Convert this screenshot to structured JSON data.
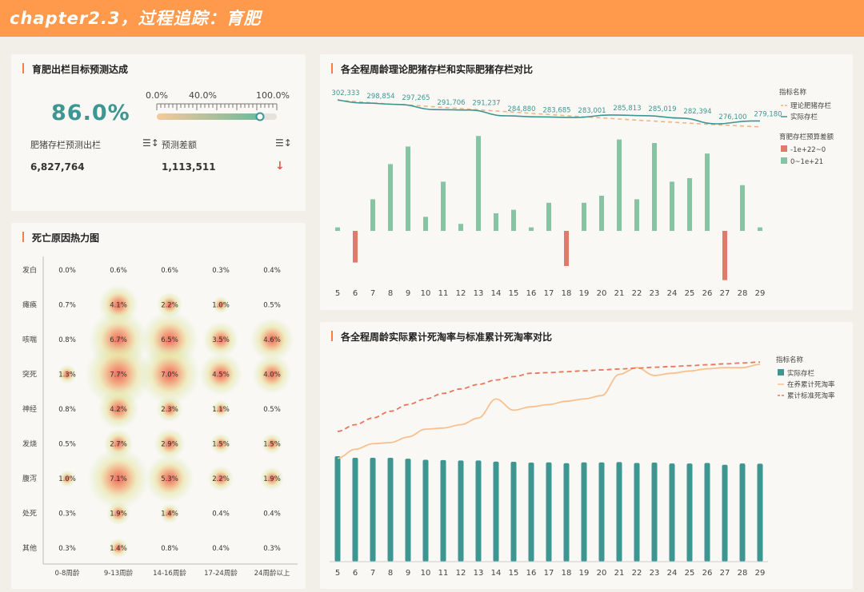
{
  "header": {
    "title": "chapter2.3，过程追踪：育肥"
  },
  "kpi": {
    "title": "育肥出栏目标预测达成",
    "rate": "86.0%",
    "rate_value": 86.0,
    "scale_min": "0.0%",
    "scale_mid": "40.0%",
    "scale_max": "100.0%",
    "metric1_label": "肥猪存栏预测出栏",
    "metric1_value": "6,827,764",
    "metric2_label": "预测差额",
    "metric2_value": "1,113,511"
  },
  "heatmap": {
    "title": "死亡原因热力图",
    "chart_data": {
      "type": "heatmap",
      "rows": [
        "发白",
        "瘫痪",
        "咳喘",
        "突死",
        "神经",
        "发烧",
        "腹泻",
        "处死",
        "其他"
      ],
      "columns": [
        "0-8周龄",
        "9-13周龄",
        "14-16周龄",
        "17-24周龄",
        "24周龄以上"
      ],
      "values": [
        [
          0.0,
          0.6,
          0.6,
          0.3,
          0.4
        ],
        [
          0.7,
          4.1,
          2.2,
          1.0,
          0.5
        ],
        [
          0.8,
          6.7,
          6.5,
          3.5,
          4.6
        ],
        [
          1.3,
          7.7,
          7.0,
          4.5,
          4.0
        ],
        [
          0.8,
          4.2,
          2.3,
          1.1,
          0.5
        ],
        [
          0.5,
          2.7,
          2.9,
          1.5,
          1.5
        ],
        [
          1.0,
          7.1,
          5.3,
          2.2,
          1.9
        ],
        [
          0.3,
          1.9,
          1.4,
          0.4,
          0.4
        ],
        [
          0.3,
          1.4,
          0.8,
          0.4,
          0.3
        ]
      ],
      "labels": [
        [
          "0.0%",
          "0.6%",
          "0.6%",
          "0.3%",
          "0.4%"
        ],
        [
          "0.7%",
          "4.1%",
          "2.2%",
          "1.0%",
          "0.5%"
        ],
        [
          "0.8%",
          "6.7%",
          "6.5%",
          "3.5%",
          "4.6%"
        ],
        [
          "1.3%",
          "7.7%",
          "7.0%",
          "4.5%",
          "4.0%"
        ],
        [
          "0.8%",
          "4.2%",
          "2.3%",
          "1.1%",
          "0.5%"
        ],
        [
          "0.5%",
          "2.7%",
          "2.9%",
          "1.5%",
          "1.5%"
        ],
        [
          "1.0%",
          "7.1%",
          "5.3%",
          "2.2%",
          "1.9%"
        ],
        [
          "0.3%",
          "1.9%",
          "1.4%",
          "0.4%",
          "0.4%"
        ],
        [
          "0.3%",
          "1.4%",
          "0.8%",
          "0.4%",
          "0.3%"
        ]
      ]
    }
  },
  "stockChart": {
    "title": "各全程周龄理论肥猪存栏和实际肥猪存栏对比",
    "chart_data": {
      "type": "line",
      "x": [
        5,
        6,
        7,
        8,
        9,
        10,
        11,
        12,
        13,
        14,
        15,
        16,
        17,
        18,
        19,
        20,
        21,
        22,
        23,
        24,
        25,
        26,
        27,
        28,
        29
      ],
      "series": [
        {
          "name": "理论肥猪存栏",
          "values": [
            302000,
            300500,
            299000,
            297800,
            296700,
            295400,
            294000,
            292800,
            291500,
            290200,
            288900,
            287600,
            286300,
            285000,
            283800,
            282600,
            281400,
            280200,
            279000,
            277900,
            276800,
            275700,
            274700,
            273700,
            272800
          ]
        },
        {
          "name": "实际存栏",
          "values": [
            302333,
            298854,
            298854,
            297265,
            297265,
            291706,
            291706,
            291237,
            291237,
            284880,
            284880,
            283685,
            283685,
            283001,
            283001,
            285813,
            285813,
            285019,
            285019,
            282394,
            282394,
            276100,
            276100,
            279180,
            279180
          ]
        }
      ],
      "point_labels": [
        "302,333",
        "298,854",
        "297,265",
        "291,706",
        "291,237",
        "284,880",
        "283,685",
        "283,001",
        "285,813",
        "285,019",
        "282,394",
        "276,100",
        "279,180"
      ],
      "diff_title": "育肥存栏预算差额",
      "diff_legend": [
        "-1e+22~0",
        "0~1e+21"
      ],
      "diff_values": [
        1,
        -9,
        9,
        19,
        24,
        4,
        14,
        2,
        27,
        5,
        6,
        1,
        8,
        -10,
        8,
        10,
        26,
        9,
        25,
        14,
        15,
        22,
        -14,
        13,
        1
      ],
      "legend_title": "指标名称",
      "colors": {
        "theory": "#f2b07a",
        "actual": "#3d9692",
        "positive": "#86c4a3",
        "negative": "#e07a6a"
      }
    }
  },
  "mortalityChart": {
    "title": "各全程周龄实际累计死淘率与标准累计死淘率对比",
    "chart_data": {
      "type": "bar",
      "x": [
        5,
        6,
        7,
        8,
        9,
        10,
        11,
        12,
        13,
        14,
        15,
        16,
        17,
        18,
        19,
        20,
        21,
        22,
        23,
        24,
        25,
        26,
        27,
        28,
        29
      ],
      "series": [
        {
          "name": "实际存栏",
          "values": [
            100,
            98.5,
            98.5,
            98.5,
            97.6,
            96.6,
            96.3,
            95.9,
            95.9,
            94.9,
            94.7,
            93.9,
            94.1,
            93.4,
            94.1,
            94.1,
            94.4,
            93.6,
            93.9,
            93.1,
            93.1,
            93.6,
            91.9,
            93.1,
            92.9
          ]
        },
        {
          "name": "在养累计死淘率",
          "values": [
            0.8,
            1.2,
            1.45,
            1.5,
            1.75,
            2.1,
            2.15,
            2.3,
            2.6,
            3.45,
            2.95,
            3.1,
            3.2,
            3.35,
            3.45,
            3.6,
            4.55,
            4.85,
            4.5,
            4.6,
            4.7,
            4.8,
            4.85,
            4.85,
            5.0
          ]
        },
        {
          "name": "累计标准死淘率",
          "values": [
            2.0,
            2.3,
            2.6,
            2.9,
            3.2,
            3.45,
            3.7,
            3.9,
            4.1,
            4.3,
            4.45,
            4.6,
            4.63,
            4.67,
            4.71,
            4.75,
            4.79,
            4.83,
            4.87,
            4.9,
            4.94,
            4.98,
            5.02,
            5.06,
            5.1
          ]
        }
      ],
      "legend_title": "指标名称",
      "colors": {
        "bar": "#3d9692",
        "rate": "#f9c08e",
        "standard": "#e8765a"
      }
    }
  }
}
